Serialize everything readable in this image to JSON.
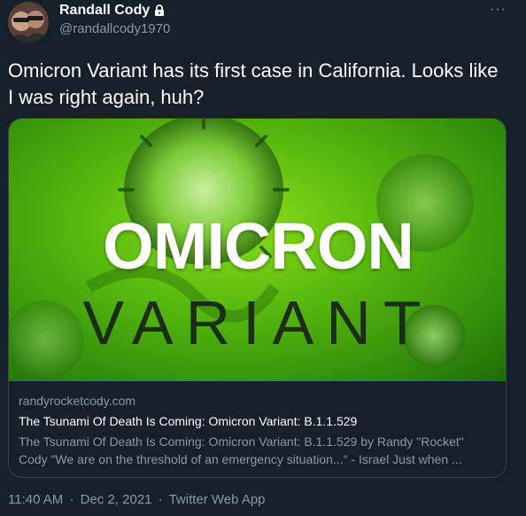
{
  "author": {
    "name": "Randall Cody",
    "handle": "@randallcody1970",
    "protected_icon": "lock-icon"
  },
  "more_label": "···",
  "tweet": {
    "text": "Omicron Variant has its first case in California. Looks like I was right again, huh?"
  },
  "card": {
    "image_title": "OMICRON",
    "image_subtitle": "VARIANT",
    "domain": "randyrocketcody.com",
    "title": "The Tsunami Of Death Is Coming: Omicron Variant: B.1.1.529",
    "description_line1": "The Tsunami Of Death Is Coming: Omicron Variant: B.1.1.529 by Randy \"Rocket\"",
    "description_line2": "Cody \"We are on the threshold of an emergency situation...\" - Israel Just when ..."
  },
  "footer": {
    "time": "11:40 AM",
    "date": "Dec 2, 2021",
    "source": "Twitter Web App",
    "separator": "·"
  },
  "colors": {
    "background": "#15202b",
    "secondary_text": "#8b98a5",
    "border": "#38444d",
    "image_green": "#56b80e"
  }
}
